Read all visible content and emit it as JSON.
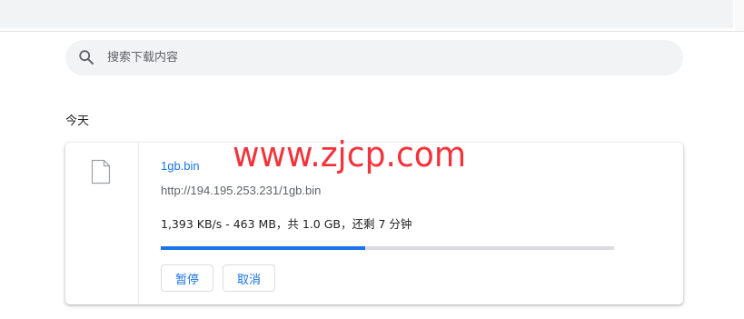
{
  "search": {
    "placeholder": "搜索下载内容",
    "icon": "search-icon"
  },
  "section": {
    "title": "今天"
  },
  "download": {
    "file_name": "1gb.bin",
    "url": "http://194.195.253.231/1gb.bin",
    "status": "1,393 KB/s - 463 MB，共 1.0 GB，还剩 7 分钟",
    "progress_fraction": 0.45,
    "icon": "file-icon",
    "pause_label": "暂停",
    "cancel_label": "取消"
  },
  "watermark": {
    "text": "www.zjcp.com"
  },
  "colors": {
    "accent": "#1a73e8",
    "watermark": "#f3333c",
    "track": "#dadce0",
    "surface": "#f1f3f4"
  }
}
